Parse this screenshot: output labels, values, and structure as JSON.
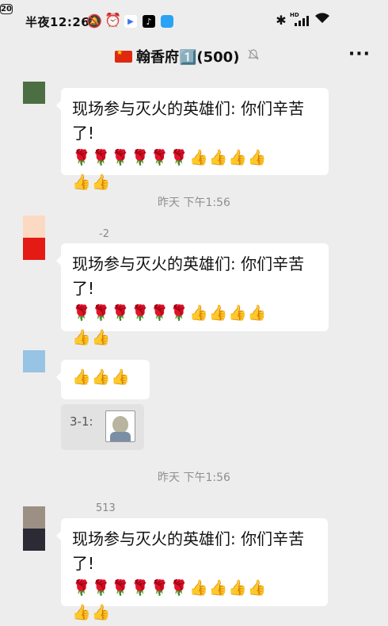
{
  "status_bar": {
    "time": "半夜12:26",
    "battery": "20",
    "network_tag": "HD"
  },
  "header": {
    "title": "翰香府1️⃣(500)"
  },
  "messages": [
    {
      "sender": "",
      "avatar_color": "#4c6e43",
      "text": "现场参与灭火的英雄们: 你们辛苦了!",
      "emoji_line1": "🌹🌹🌹🌹🌹🌹👍👍👍👍",
      "emoji_line2": "👍👍"
    },
    {
      "timestamp": "昨天 下午1:56"
    },
    {
      "sender": "-2",
      "avatar_color": "#e31b14",
      "avatar_top_color": "#fbd9c3",
      "text": "现场参与灭火的英雄们: 你们辛苦了!",
      "emoji_line1": "🌹🌹🌹🌹🌹🌹👍👍👍👍",
      "emoji_line2": "👍👍"
    },
    {
      "sender": "",
      "avatar_color": "#97c3e5",
      "text": "👍👍👍",
      "quote": "3-1:"
    },
    {
      "timestamp": "昨天 下午1:56"
    },
    {
      "sender": "513",
      "avatar_color": "#2b2a35",
      "avatar_top_color": "#9c9085",
      "text": "现场参与灭火的英雄们: 你们辛苦了!",
      "emoji_line1": "🌹🌹🌹🌹🌹🌹👍👍👍👍",
      "emoji_line2": "👍👍"
    }
  ],
  "icons": {
    "mute": "bell-slash-icon",
    "more": "more-icon"
  }
}
